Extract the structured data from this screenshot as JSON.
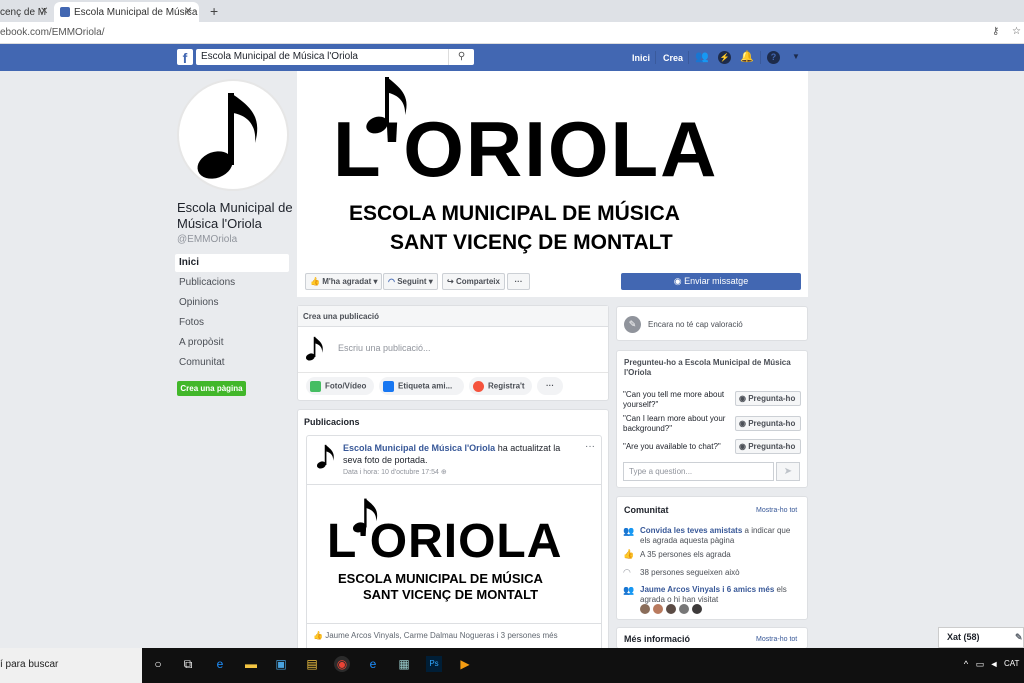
{
  "browser": {
    "tab1": "cenç de M",
    "tab2": "Escola Municipal de Música l'Orio",
    "url": "ebook.com/EMMOriola/"
  },
  "fb": {
    "search": "Escola Municipal de Música l'Oriola",
    "nav_home": "Inici",
    "nav_create": "Crea"
  },
  "page": {
    "name": "Escola Municipal de Música l'Oriola",
    "handle": "@EMMOriola",
    "nav": [
      "Inici",
      "Publicacions",
      "Opinions",
      "Fotos",
      "A propòsit",
      "Comunitat"
    ],
    "create_page": "Crea una pàgina"
  },
  "cover": {
    "logo": "L'ORIOLA",
    "line1": "ESCOLA MUNICIPAL DE MÚSICA",
    "line2": "SANT VICENÇ DE MONTALT"
  },
  "actions": {
    "like": "M'ha agradat",
    "follow": "Seguint",
    "share": "Comparteix",
    "more": "···",
    "send": "Enviar missatge"
  },
  "composer": {
    "title": "Crea una publicació",
    "placeholder": "Escriu una publicació...",
    "photo": "Foto/Vídeo",
    "tag": "Etiqueta ami...",
    "checkin": "Registra't",
    "more": "···"
  },
  "posts": {
    "title": "Publicacions",
    "author": "Escola Municipal de Música l'Oriola",
    "action": "ha actualitzat la seva foto de portada.",
    "date": "Data i hora: 10 d'octubre 17:54",
    "more": "···",
    "reactions": "Jaume Arcos Vinyals, Carme Dalmau Nogueras i 3 persones més"
  },
  "rating": {
    "text": "Encara no té cap valoració"
  },
  "ask": {
    "title": "Pregunteu-ho a Escola Municipal de Música l'Oriola",
    "questions": [
      "\"Can you tell me more about yourself?\"",
      "\"Can I learn more about your background?\"",
      "\"Are you available to chat?\""
    ],
    "button": "Pregunta-ho",
    "placeholder": "Type a question..."
  },
  "community": {
    "title": "Comunitat",
    "see_all": "Mostra-ho tot",
    "invite_link": "Convida les teves amistats",
    "invite_rest": "a indicar que els agrada aquesta pàgina",
    "likes": "A 35 persones els agrada",
    "follows": "38 persones segueixen això",
    "friends_link": "Jaume Arcos Vinyals i 6 amics més",
    "friends_rest": "els agrada o hi han visitat"
  },
  "more_info": {
    "title": "Més informació",
    "see_all": "Mostra-ho tot"
  },
  "chat": {
    "label": "Xat (58)"
  },
  "taskbar": {
    "search": "í para buscar",
    "lang": "CAT"
  }
}
